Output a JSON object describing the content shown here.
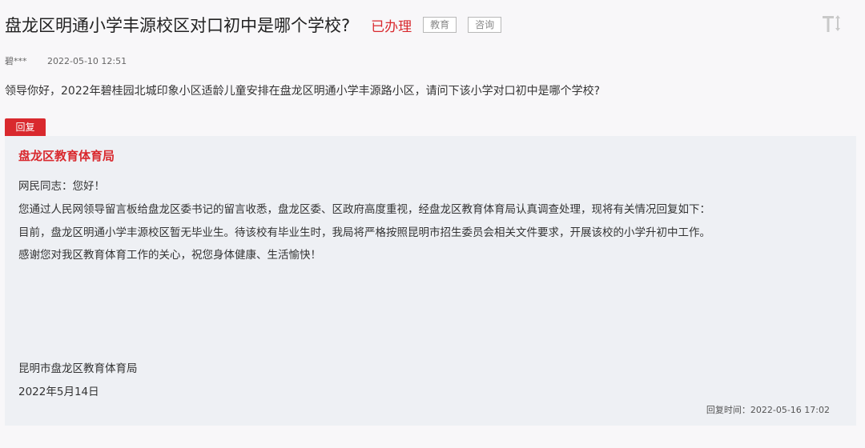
{
  "post": {
    "title": "盘龙区明通小学丰源校区对口初中是哪个学校?",
    "status": "已办理",
    "tags": [
      "教育",
      "咨询"
    ],
    "font_size_icon": "font-size-icon",
    "author": "碧***",
    "date": "2022-05-10 12:51",
    "question": "领导你好，2022年碧桂园北城印象小区适龄儿童安排在盘龙区明通小学丰源路小区，请问下该小学对口初中是哪个学校?"
  },
  "reply": {
    "tag_label": "回复",
    "org_name": "盘龙区教育体育局",
    "lines": [
      "网民同志：您好！",
      "您通过人民网领导留言板给盘龙区委书记的留言收悉，盘龙区委、区政府高度重视，经盘龙区教育体育局认真调查处理，现将有关情况回复如下：",
      "目前，盘龙区明通小学丰源校区暂无毕业生。待该校有毕业生时，我局将严格按照昆明市招生委员会相关文件要求，开展该校的小学升初中工作。",
      "感谢您对我区教育体育工作的关心，祝您身体健康、生活愉快！"
    ],
    "signature_org": "昆明市盘龙区教育体育局",
    "signature_date": "2022年5月14日",
    "reply_time": "回复时间：2022-05-16 17:02"
  },
  "colors": {
    "accent": "#d9292e",
    "page_background": "#f8f7f9",
    "reply_background": "#eef0f4",
    "tag_border": "#b8b8b8"
  }
}
